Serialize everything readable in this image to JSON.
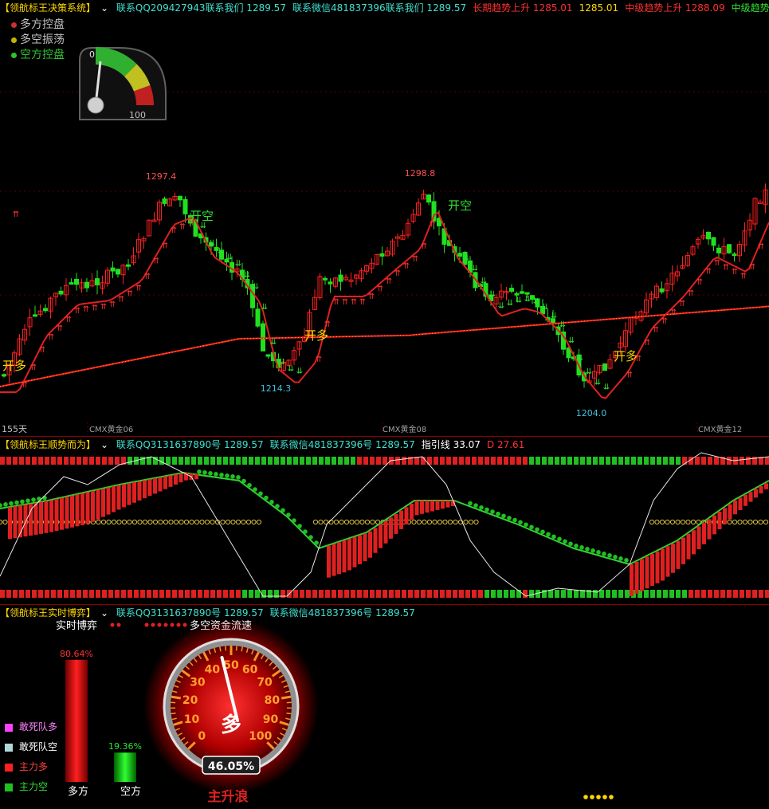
{
  "panel1": {
    "title": "【领航标王决策系统】",
    "items": [
      {
        "text": "联系QQ209427943联系我们 1289.57",
        "c": "cyan"
      },
      {
        "text": "联系微信481837396联系我们 1289.57",
        "c": "cyan"
      },
      {
        "text": "长期趋势上升 1285.01",
        "c": "red"
      },
      {
        "text": "1285.01",
        "c": "yellow"
      },
      {
        "text": "中级趋势上升 1288.09",
        "c": "red"
      },
      {
        "text": "中级趋势下降",
        "c": "green"
      }
    ],
    "legend": [
      {
        "text": "多方控盘",
        "color": "#cc3030"
      },
      {
        "text": "多空振荡",
        "color": "#c8b400"
      },
      {
        "text": "空方控盘",
        "color": "#30c030"
      }
    ],
    "gauge": {
      "min_label": "0",
      "max_label": "100",
      "value": 12
    },
    "period_label": "155天",
    "contract_labels": [
      "CMX黄金06",
      "CMX黄金08",
      "CMX黄金12"
    ],
    "price_labels": [
      "1297.4",
      "1298.8",
      "1214.3",
      "1204.0"
    ],
    "signals": [
      "开多",
      "开空",
      "开多",
      "开空",
      "开多"
    ]
  },
  "panel2": {
    "title": "【领航标王顺势而为】",
    "items": [
      {
        "text": "联系QQ3131637890号 1289.57",
        "c": "cyan"
      },
      {
        "text": "联系微信481837396号 1289.57",
        "c": "cyan"
      },
      {
        "text": "指引线 33.07",
        "c": "white"
      },
      {
        "text": "D 27.61",
        "c": "red"
      }
    ]
  },
  "panel3": {
    "title": "【领航标王实时博弈】",
    "items": [
      {
        "text": "联系QQ3131637890号 1289.57",
        "c": "cyan"
      },
      {
        "text": "联系微信481837396号 1289.57",
        "c": "cyan"
      }
    ],
    "sub1": "实时博弈",
    "sub2": "多空资金流速",
    "bull_pct": "80.64%",
    "bear_pct": "19.36%",
    "bull_label": "多方",
    "bear_label": "空方",
    "legend": [
      {
        "text": "敢死队多",
        "color": "#ff40ff"
      },
      {
        "text": "敢死队空",
        "color": "#b0d8d8"
      },
      {
        "text": "主力多",
        "color": "#ff2020"
      },
      {
        "text": "主力空",
        "color": "#20c020"
      }
    ],
    "dial": {
      "ticks": [
        "0",
        "10",
        "20",
        "30",
        "40",
        "50",
        "60",
        "70",
        "80",
        "90",
        "100"
      ],
      "center": "多",
      "readout": "46.05%",
      "value": 46.05,
      "caption": "主升浪"
    }
  },
  "chart_data": [
    {
      "type": "candlestick",
      "title": "【领航标王决策系统】",
      "annotations": [
        {
          "label": "1297.4",
          "kind": "high"
        },
        {
          "label": "1298.8",
          "kind": "high"
        },
        {
          "label": "1214.3",
          "kind": "low"
        },
        {
          "label": "1204.0",
          "kind": "low"
        }
      ],
      "x_labels": [
        "155天",
        "CMX黄金06",
        "CMX黄金08",
        "CMX黄金12"
      ],
      "signals": [
        "开多",
        "开空",
        "开多",
        "开空",
        "开多"
      ]
    },
    {
      "type": "line",
      "title": "【领航标王顺势而为】",
      "series": [
        {
          "name": "指引线",
          "last": 33.07
        },
        {
          "name": "D",
          "last": 27.61
        }
      ]
    },
    {
      "type": "bar",
      "title": "【领航标王实时博弈】",
      "categories": [
        "多方",
        "空方"
      ],
      "values": [
        80.64,
        19.36
      ]
    }
  ]
}
